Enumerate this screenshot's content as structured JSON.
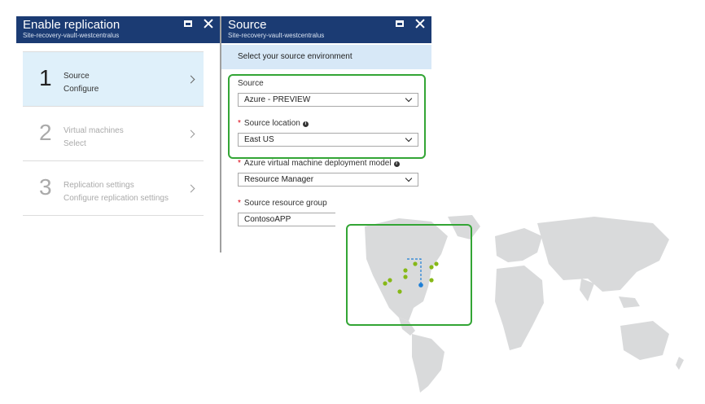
{
  "left_blade": {
    "title": "Enable replication",
    "subtitle": "Site-recovery-vault-westcentralus",
    "steps": [
      {
        "number": "1",
        "title": "Source",
        "subtitle": "Configure",
        "active": true
      },
      {
        "number": "2",
        "title": "Virtual machines",
        "subtitle": "Select",
        "active": false
      },
      {
        "number": "3",
        "title": "Replication settings",
        "subtitle": "Configure replication settings",
        "active": false
      }
    ]
  },
  "right_blade": {
    "title": "Source",
    "subtitle": "Site-recovery-vault-westcentralus",
    "banner": "Select your source environment",
    "fields": {
      "source": {
        "label": "Source",
        "value": "Azure - PREVIEW"
      },
      "source_location": {
        "label": "Source location",
        "value": "East US",
        "required": true
      },
      "deployment_model": {
        "label": "Azure virtual machine deployment model",
        "value": "Resource Manager",
        "required": true
      },
      "resource_group": {
        "label": "Source resource group",
        "value": "ContosoAPP",
        "required": true
      }
    }
  },
  "icons": [
    "maximize-icon",
    "close-icon",
    "chevron-right-icon",
    "chevron-down-icon",
    "info-icon",
    "map-pin-icon"
  ],
  "colors": {
    "header_bg": "#1b3b73",
    "active_step_bg": "#dff0fa",
    "banner_bg": "#d7e8f7",
    "highlight": "#33a535",
    "pin_green": "#86b817",
    "pin_blue": "#1e7fd6",
    "map_land": "#d9dadb",
    "required": "#dd0011"
  }
}
